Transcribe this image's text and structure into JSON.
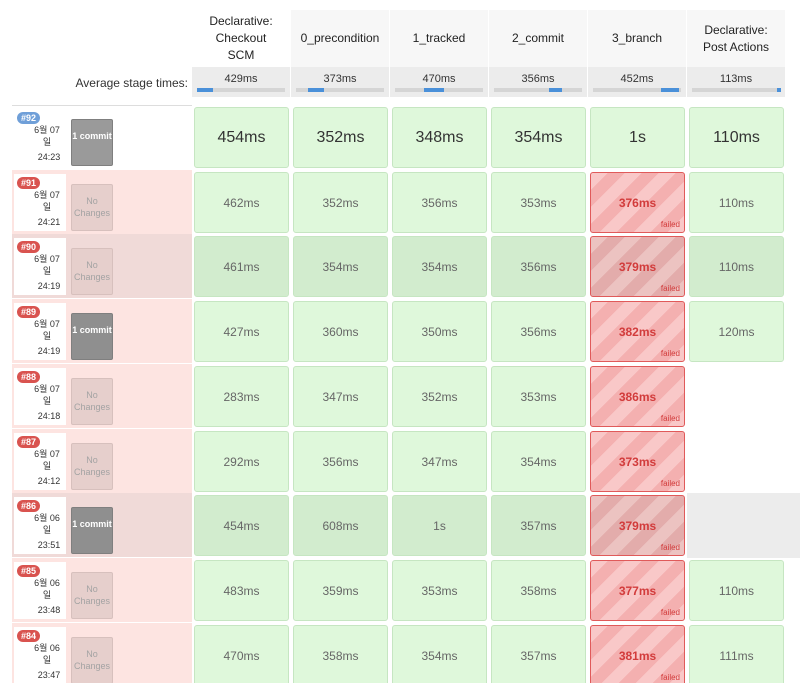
{
  "stages": [
    {
      "name": "Declarative: Checkout SCM",
      "avg": "429ms",
      "bar": 0.18
    },
    {
      "name": "0_precondition",
      "avg": "373ms",
      "bar": 0.18
    },
    {
      "name": "1_tracked",
      "avg": "470ms",
      "bar": 0.22
    },
    {
      "name": "2_commit",
      "avg": "356ms",
      "bar": 0.15
    },
    {
      "name": "3_branch",
      "avg": "452ms",
      "bar": 0.2
    },
    {
      "name": "Declarative: Post Actions",
      "avg": "113ms",
      "bar": 0.05
    }
  ],
  "avg_label": "Average stage times:",
  "status_text": {
    "failed": "failed"
  },
  "colors": {
    "success_cell": "#dff8db",
    "failed_border": "#e05a5a",
    "row_fail_bg": "#fde4e1",
    "badge_blue": "#6f9fd8",
    "badge_red": "#d9534f"
  },
  "builds": [
    {
      "num": "#92",
      "date": "6월 07 일",
      "time": "24:23",
      "changes": "1 commit",
      "row": "ok",
      "cells": [
        {
          "v": "454ms",
          "s": "ok"
        },
        {
          "v": "352ms",
          "s": "ok"
        },
        {
          "v": "348ms",
          "s": "ok"
        },
        {
          "v": "354ms",
          "s": "ok"
        },
        {
          "v": "1s",
          "s": "ok"
        },
        {
          "v": "110ms",
          "s": "ok"
        }
      ]
    },
    {
      "num": "#91",
      "date": "6월 07 일",
      "time": "24:21",
      "changes": "No Changes",
      "row": "fail",
      "cells": [
        {
          "v": "462ms",
          "s": "ok"
        },
        {
          "v": "352ms",
          "s": "ok"
        },
        {
          "v": "356ms",
          "s": "ok"
        },
        {
          "v": "353ms",
          "s": "ok"
        },
        {
          "v": "376ms",
          "s": "fail"
        },
        {
          "v": "110ms",
          "s": "ok"
        }
      ]
    },
    {
      "num": "#90",
      "date": "6월 07 일",
      "time": "24:19",
      "changes": "No Changes",
      "row": "fail-dim",
      "cells": [
        {
          "v": "461ms",
          "s": "ok"
        },
        {
          "v": "354ms",
          "s": "ok"
        },
        {
          "v": "354ms",
          "s": "ok"
        },
        {
          "v": "356ms",
          "s": "ok"
        },
        {
          "v": "379ms",
          "s": "fail"
        },
        {
          "v": "110ms",
          "s": "ok"
        }
      ]
    },
    {
      "num": "#89",
      "date": "6월 07 일",
      "time": "24:19",
      "changes": "1 commit",
      "row": "fail",
      "cells": [
        {
          "v": "427ms",
          "s": "ok"
        },
        {
          "v": "360ms",
          "s": "ok"
        },
        {
          "v": "350ms",
          "s": "ok"
        },
        {
          "v": "356ms",
          "s": "ok"
        },
        {
          "v": "382ms",
          "s": "fail"
        },
        {
          "v": "120ms",
          "s": "ok"
        }
      ]
    },
    {
      "num": "#88",
      "date": "6월 07 일",
      "time": "24:18",
      "changes": "No Changes",
      "row": "fail",
      "cells": [
        {
          "v": "283ms",
          "s": "ok"
        },
        {
          "v": "347ms",
          "s": "ok"
        },
        {
          "v": "352ms",
          "s": "ok"
        },
        {
          "v": "353ms",
          "s": "ok"
        },
        {
          "v": "386ms",
          "s": "fail"
        },
        {
          "v": "",
          "s": "empty"
        }
      ]
    },
    {
      "num": "#87",
      "date": "6월 07 일",
      "time": "24:12",
      "changes": "No Changes",
      "row": "fail",
      "cells": [
        {
          "v": "292ms",
          "s": "ok"
        },
        {
          "v": "356ms",
          "s": "ok"
        },
        {
          "v": "347ms",
          "s": "ok"
        },
        {
          "v": "354ms",
          "s": "ok"
        },
        {
          "v": "373ms",
          "s": "fail"
        },
        {
          "v": "",
          "s": "empty"
        }
      ]
    },
    {
      "num": "#86",
      "date": "6월 06 일",
      "time": "23:51",
      "changes": "1 commit",
      "row": "fail-dim",
      "cells": [
        {
          "v": "454ms",
          "s": "ok"
        },
        {
          "v": "608ms",
          "s": "ok"
        },
        {
          "v": "1s",
          "s": "ok"
        },
        {
          "v": "357ms",
          "s": "ok"
        },
        {
          "v": "379ms",
          "s": "fail"
        },
        {
          "v": "",
          "s": "empty"
        }
      ]
    },
    {
      "num": "#85",
      "date": "6월 06 일",
      "time": "23:48",
      "changes": "No Changes",
      "row": "fail",
      "cells": [
        {
          "v": "483ms",
          "s": "ok"
        },
        {
          "v": "359ms",
          "s": "ok"
        },
        {
          "v": "353ms",
          "s": "ok"
        },
        {
          "v": "358ms",
          "s": "ok"
        },
        {
          "v": "377ms",
          "s": "fail"
        },
        {
          "v": "110ms",
          "s": "ok"
        }
      ]
    },
    {
      "num": "#84",
      "date": "6월 06 일",
      "time": "23:47",
      "changes": "No Changes",
      "row": "fail",
      "cells": [
        {
          "v": "470ms",
          "s": "ok"
        },
        {
          "v": "358ms",
          "s": "ok"
        },
        {
          "v": "354ms",
          "s": "ok"
        },
        {
          "v": "357ms",
          "s": "ok"
        },
        {
          "v": "381ms",
          "s": "fail"
        },
        {
          "v": "111ms",
          "s": "ok"
        }
      ]
    }
  ]
}
